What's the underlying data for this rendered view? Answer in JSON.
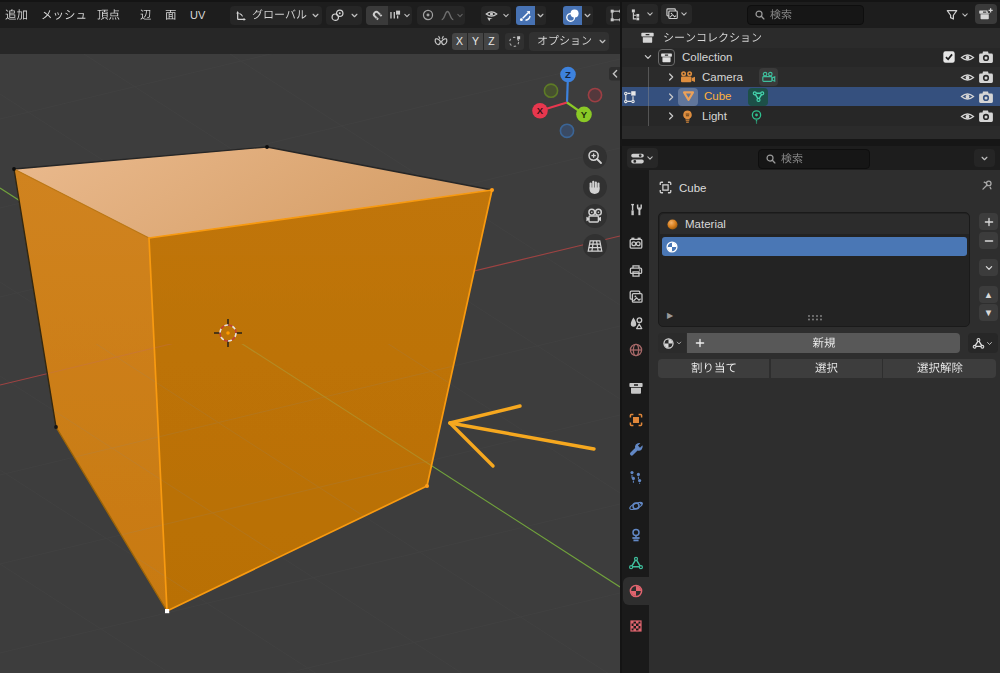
{
  "app": "Blender 3D viewport (edit mode) with outliner and material properties",
  "colors": {
    "accent_blue": "#4772b3",
    "selected_row_blue": "#35507e",
    "slot_selected_blue": "#4a77b5",
    "cube_left_face": "#cc7e15",
    "cube_right_face": "#bd7309",
    "cube_top_face": "#e2ac79",
    "cube_edge_selected": "#f89a10",
    "annotation_arrow": "#f6a81f",
    "axis_x_red": "#9e4342",
    "axis_y_green": "#71a33c",
    "gizmo_x": "#e8374e",
    "gizmo_y": "#8ac926",
    "gizmo_z": "#3d82dd",
    "active_object_text": "#ffb13b",
    "viewport_bg": "#3d3d3d",
    "header_bg": "#1d1d1d",
    "panel_bg": "#2e2e2e"
  },
  "viewport_header": {
    "menus": [
      {
        "label": "追加"
      },
      {
        "label": "メッシュ"
      },
      {
        "label": "頂点"
      },
      {
        "label": "辺"
      },
      {
        "label": "面"
      },
      {
        "label": "UV"
      }
    ],
    "orientation": {
      "label": "グローバル",
      "icon": "orientation-global-icon"
    },
    "pivot_icon": "pivot-point-icon",
    "snap_icons": [
      "magnet-icon",
      "snap-increment-icon"
    ],
    "proportional_icons": [
      "proportional-editing-icon",
      "falloff-curve-icon"
    ],
    "visibility_icon": "object-type-visibility-eye-icon",
    "gizmo_toggle_icon": "show-gizmo-icon",
    "overlays_toggle_icon": "show-overlays-icon",
    "xray_icon": "toggle-xray-icon"
  },
  "tool_settings": {
    "mirror_icon": "mirror-butterfly-icon",
    "mirror_axes": [
      "X",
      "Y",
      "Z"
    ],
    "automerge_icon": "auto-merge-icon",
    "options_label": "オプション"
  },
  "viewport": {
    "gizmo_axes": [
      "X",
      "Y",
      "Z"
    ],
    "nav_buttons": [
      "zoom-icon",
      "pan-hand-icon",
      "camera-view-icon",
      "toggle-ortho-grid-icon"
    ],
    "sidebar_collapse": "‹",
    "scene": {
      "object": "Cube",
      "mode": "edit-mode-all-selected",
      "annotation": "orange arrow pointing at cube"
    }
  },
  "outliner": {
    "search_placeholder": "検索",
    "filter_icon": "filter-funnel-icon",
    "new_collection_icon": "new-collection-icon",
    "tree": [
      {
        "label": "シーンコレクション",
        "icon": "scene-collection-icon",
        "depth": 0
      },
      {
        "label": "Collection",
        "icon": "collection-icon",
        "depth": 1,
        "expanded": true,
        "right": [
          "checkbox-checked",
          "eye-icon",
          "camera-restrict-icon"
        ]
      },
      {
        "label": "Camera",
        "icon": "camera-object-icon",
        "depth": 2,
        "right": [
          "eye-icon",
          "camera-restrict-icon"
        ]
      },
      {
        "label": "Cube",
        "icon": "mesh-object-icon",
        "depth": 2,
        "selected": true,
        "active": true,
        "mode_icon": "edit-mode-icon",
        "right": [
          "eye-icon",
          "camera-restrict-icon"
        ]
      },
      {
        "label": "Light",
        "icon": "light-object-icon",
        "depth": 2,
        "right": [
          "eye-icon",
          "camera-restrict-icon"
        ]
      }
    ]
  },
  "properties": {
    "search_placeholder": "検索",
    "breadcrumb": {
      "object": "Cube"
    },
    "tabs": [
      {
        "name": "tool"
      },
      {
        "name": "render"
      },
      {
        "name": "output"
      },
      {
        "name": "view-layer"
      },
      {
        "name": "scene"
      },
      {
        "name": "world"
      },
      {
        "name": "collection"
      },
      {
        "name": "object"
      },
      {
        "name": "modifiers"
      },
      {
        "name": "particles"
      },
      {
        "name": "physics"
      },
      {
        "name": "constraints"
      },
      {
        "name": "object-data"
      },
      {
        "name": "material",
        "active": true
      },
      {
        "name": "texture"
      }
    ],
    "material_slots": [
      {
        "name": "Material",
        "icon": "material-preview-ball"
      },
      {
        "name": "",
        "icon": "material-icon",
        "selected": true
      }
    ],
    "slot_buttons": [
      "add",
      "remove",
      "specials",
      "move-up",
      "move-down"
    ],
    "datablock": {
      "browse_icon": "material-icon",
      "new_label": "新規",
      "link_icon": "node-tree-icon"
    },
    "ops": [
      {
        "label": "割り当て"
      },
      {
        "label": "選択"
      },
      {
        "label": "選択解除"
      }
    ]
  }
}
